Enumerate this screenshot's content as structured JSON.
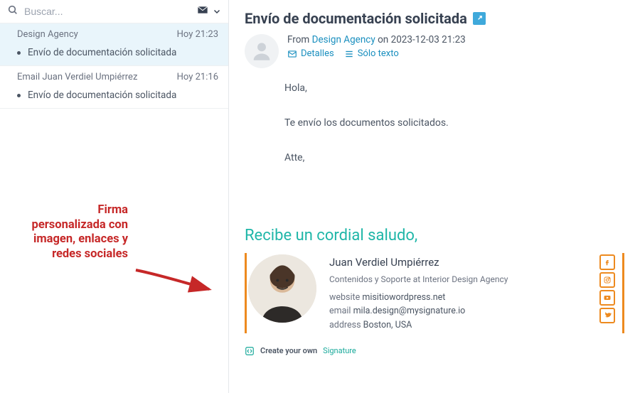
{
  "search": {
    "placeholder": "Buscar..."
  },
  "sidebar": {
    "items": [
      {
        "sender": "Design Agency",
        "time": "Hoy 21:23",
        "subject": "Envío de documentación solicitada",
        "selected": true
      },
      {
        "sender": "Email Juan Verdiel Umpiérrez",
        "time": "Hoy 21:16",
        "subject": "Envío de documentación solicitada",
        "selected": false
      }
    ]
  },
  "message": {
    "title": "Envío de documentación solicitada",
    "from_label": "From",
    "from_name": "Design Agency",
    "on_label": "on",
    "datetime": "2023-12-03 21:23",
    "details_label": "Detalles",
    "plaintext_label": "Sólo texto",
    "body": {
      "line1": "Hola,",
      "line2": "Te envío los documentos solicitados.",
      "line3": "Atte,"
    }
  },
  "signature": {
    "greeting": "Recibe un cordial saludo,",
    "name": "Juan Verdiel Umpiérrez",
    "role": "Contenidos y Soporte at Interior Design Agency",
    "website_key": "website",
    "website_val": "misitiowordpress.net",
    "email_key": "email",
    "email_val": "mila.design@mysignature.io",
    "address_key": "address",
    "address_val": "Boston, USA",
    "footer_own": "Create your own",
    "footer_link": "Signature"
  },
  "annotation": {
    "text": "Firma personalizada con imagen, enlaces y redes sociales"
  }
}
